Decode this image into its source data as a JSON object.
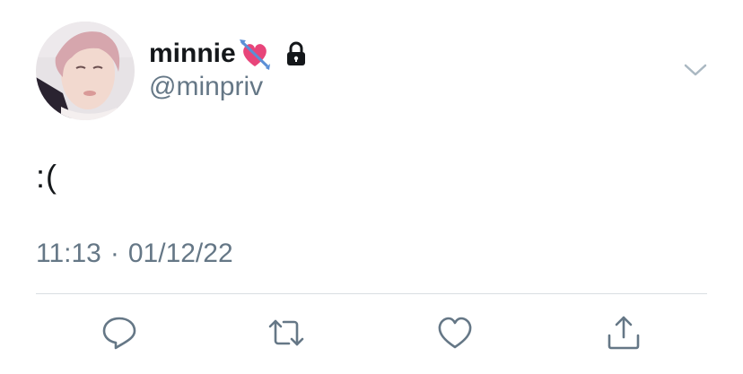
{
  "tweet": {
    "display_name": "minnie",
    "handle": "@minpriv",
    "text": ":(",
    "time": "11:13",
    "separator": "·",
    "date": "01/12/22",
    "badges": [
      "heart-with-arrow-emoji",
      "lock-icon"
    ]
  },
  "actions": {
    "icons": [
      "reply-icon",
      "retweet-icon",
      "like-icon",
      "share-icon"
    ]
  },
  "colors": {
    "primary_text": "#14171a",
    "secondary_text": "#657786",
    "icon": "#657786",
    "divider": "#d9dee2",
    "emoji_pink": "#e8457a",
    "arrow_blue": "#5b8fd6"
  }
}
